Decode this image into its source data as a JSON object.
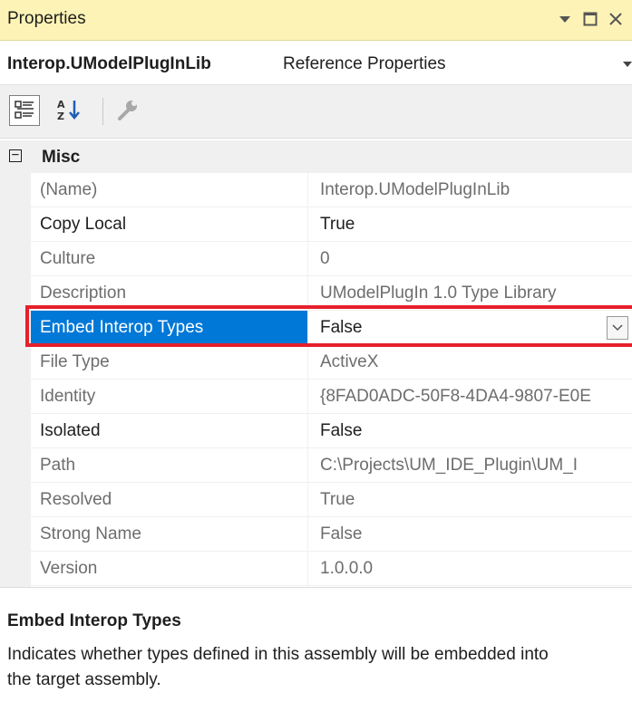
{
  "window": {
    "title": "Properties",
    "pin_icon": "dropdown-arrow-icon",
    "maximize_icon": "maximize-icon",
    "close_icon": "close-icon"
  },
  "object_selector": {
    "name": "Interop.UModelPlugInLib",
    "type": "Reference Properties"
  },
  "toolbar": {
    "buttons": [
      "categorized-icon",
      "alphabetical-icon",
      "property-pages-icon"
    ]
  },
  "grid": {
    "category": "Misc",
    "rows": [
      {
        "name": "(Name)",
        "value": "Interop.UModelPlugInLib",
        "editable": false
      },
      {
        "name": "Copy Local",
        "value": "True",
        "editable": true
      },
      {
        "name": "Culture",
        "value": "0",
        "editable": false
      },
      {
        "name": "Description",
        "value": "UModelPlugIn 1.0 Type Library",
        "editable": false
      },
      {
        "name": "Embed Interop Types",
        "value": "False",
        "editable": true,
        "selected": true
      },
      {
        "name": "File Type",
        "value": "ActiveX",
        "editable": false
      },
      {
        "name": "Identity",
        "value": "{8FAD0ADC-50F8-4DA4-9807-E0E",
        "editable": false
      },
      {
        "name": "Isolated",
        "value": "False",
        "editable": true
      },
      {
        "name": "Path",
        "value": "C:\\Projects\\UM_IDE_Plugin\\UM_I",
        "editable": false
      },
      {
        "name": "Resolved",
        "value": "True",
        "editable": false
      },
      {
        "name": "Strong Name",
        "value": "False",
        "editable": false
      },
      {
        "name": "Version",
        "value": "1.0.0.0",
        "editable": false
      }
    ]
  },
  "description": {
    "title": "Embed Interop Types",
    "text": "Indicates whether types defined in this assembly will be embedded into the target assembly."
  },
  "colors": {
    "titlebar": "#fdf3b6",
    "selection": "#0078d7",
    "highlight_border": "#e5202b"
  }
}
